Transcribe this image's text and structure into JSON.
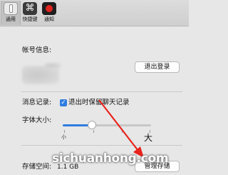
{
  "toolbar": {
    "items": [
      {
        "label": "通用",
        "icon": "general-icon",
        "active": true
      },
      {
        "label": "快捷键",
        "icon": "command-key-icon",
        "symbol": "⌘"
      },
      {
        "label": "通知",
        "icon": "record-icon"
      }
    ]
  },
  "account": {
    "label": "帐号信息:",
    "logout_label": "退出登录"
  },
  "messages": {
    "label": "消息记录:",
    "keep_history_label": "退出时保留聊天记录",
    "keep_history_checked": true
  },
  "font_size": {
    "label": "字体大小:",
    "small_label": "小",
    "large_label": "大",
    "level": 0.33
  },
  "storage": {
    "label": "存储空间:",
    "value": "1.1 GB",
    "manage_label": "管理存储"
  },
  "watermark": {
    "text": "sichuanhong.com"
  },
  "colors": {
    "accent": "#2f7de0",
    "annotation_arrow": "#e8231c"
  }
}
